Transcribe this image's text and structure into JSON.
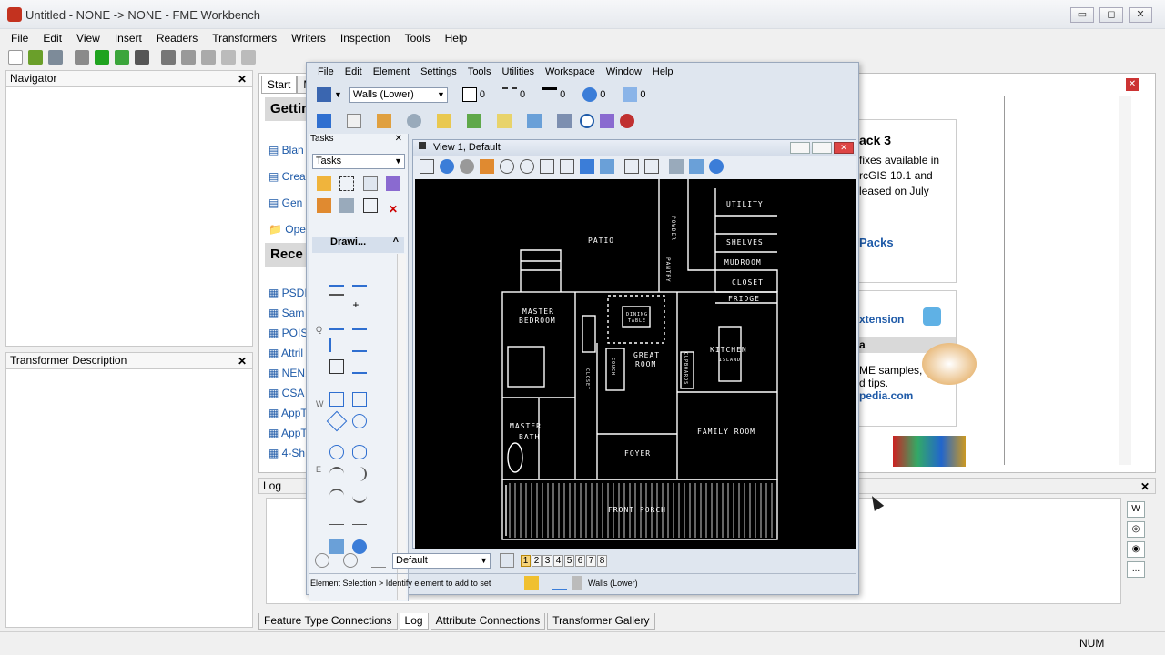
{
  "window": {
    "title": "Untitled - NONE -> NONE - FME Workbench",
    "btn_min": "▭",
    "btn_max": "◻",
    "btn_close": "✕"
  },
  "menu": [
    "File",
    "Edit",
    "View",
    "Insert",
    "Readers",
    "Transformers",
    "Writers",
    "Inspection",
    "Tools",
    "Help"
  ],
  "navigator": {
    "title": "Navigator",
    "close": "✕"
  },
  "transformer_desc": {
    "title": "Transformer Description",
    "close": "✕"
  },
  "start": {
    "tabs": [
      "Start",
      "M"
    ],
    "getting": "Gettin",
    "items": [
      "Blan",
      "Crea",
      "Gen",
      "Ope"
    ],
    "recent_heading": "Rece",
    "recent": [
      "PSDI",
      "Sam",
      "POIS",
      "Attril",
      "NEN1",
      "CSA",
      "AppT",
      "AppT",
      "4-Sh"
    ]
  },
  "right_content": {
    "pack": "ack 3",
    "text1": "fixes available in",
    "text2": "rcGIS 10.1 and",
    "text3": "leased on July",
    "packs": "Packs",
    "extension": "xtension",
    "a": "a",
    "samples": "ME samples,",
    "tips": "d tips.",
    "pedia": "pedia.com"
  },
  "log": {
    "title": "Log",
    "close": "✕",
    "more": "..."
  },
  "bottom_tabs": [
    "Feature Type Connections",
    "Log",
    "Attribute Connections",
    "Transformer Gallery"
  ],
  "status": {
    "num": "NUM"
  },
  "ms": {
    "menu": [
      "File",
      "Edit",
      "Element",
      "Settings",
      "Tools",
      "Utilities",
      "Workspace",
      "Window",
      "Help"
    ],
    "level": "Walls (Lower)",
    "zero": "0",
    "tasks_title": "Tasks",
    "tasks_drop": "Tasks",
    "drawing": "Drawi...",
    "side_letters": [
      "Q",
      "W",
      "E"
    ],
    "view_title": "View 1, Default",
    "view_drop": "Default",
    "views": [
      "1",
      "2",
      "3",
      "4",
      "5",
      "6",
      "7",
      "8"
    ],
    "status_text": "Element Selection > Identify element to add to set",
    "status_level": "Walls (Lower)"
  },
  "plan_labels": {
    "patio": "PATIO",
    "utility": "UTILITY",
    "shelves": "SHELVES",
    "mudroom": "MUDROOM",
    "closet": "CLOSET",
    "fridge": "FRIDGE",
    "master_bedroom": "MASTER",
    "bedroom": "BEDROOM",
    "dining": "DINING",
    "table": "TABLE",
    "great": "GREAT",
    "room": "ROOM",
    "kitchen": "KITCHEN",
    "island": "ISLAND",
    "master_bath": "MASTER",
    "bath": "BATH",
    "foyer": "FOYER",
    "family_room": "FAMILY ROOM",
    "front_porch": "FRONT PORCH",
    "powder": "POWDER",
    "pantry": "PANTRY",
    "closet_v": "CLOSET",
    "couch": "COUCH",
    "cupboards": "CUPBOARDS"
  },
  "colors": {
    "accent": "#1e5aa8",
    "plan_bg": "#000000",
    "plan_line": "#ffffff"
  }
}
